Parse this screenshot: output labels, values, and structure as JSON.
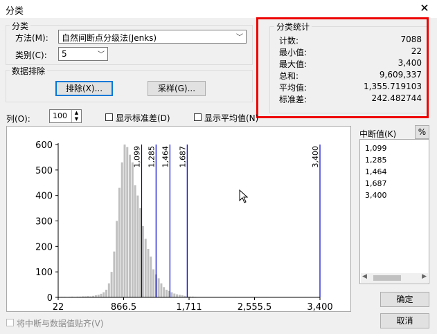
{
  "window": {
    "title": "分类",
    "close_glyph": "✕"
  },
  "classification": {
    "group_label": "分类",
    "method_label": "方法(M):",
    "method_value": "自然间断点分级法(Jenks)",
    "classes_label": "类别(C):",
    "classes_value": "5"
  },
  "exclusion": {
    "group_label": "数据排除",
    "exclude_button": "排除(X)...",
    "sample_button": "采样(G)..."
  },
  "stats": {
    "group_label": "分类统计",
    "rows": [
      {
        "label": "计数:",
        "value": "7088"
      },
      {
        "label": "最小值:",
        "value": "22"
      },
      {
        "label": "最大值:",
        "value": "3,400"
      },
      {
        "label": "总和:",
        "value": "9,609,337"
      },
      {
        "label": "平均值:",
        "value": "1,355.719103"
      },
      {
        "label": "标准差:",
        "value": "242.482744"
      }
    ]
  },
  "columns": {
    "label": "列(O):",
    "value": "100",
    "show_std": "显示标准差(D)",
    "show_mean": "显示平均值(N)"
  },
  "breaks": {
    "label": "中断值(K)",
    "percent_button": "%",
    "values": [
      "1,099",
      "1,285",
      "1,464",
      "1,687",
      "3,400"
    ]
  },
  "buttons": {
    "ok": "确定",
    "cancel": "取消"
  },
  "snap": {
    "label": "将中断与数据值贴齐(V)"
  },
  "colors": {
    "bar": "#c0c0c0",
    "break_line": "#0000cc",
    "highlight": "#e00000"
  },
  "chart_data": {
    "type": "bar",
    "xlim": [
      22,
      3400
    ],
    "ylim": [
      0,
      600
    ],
    "x_ticks": [
      22,
      866.5,
      1711,
      2555.5,
      3400
    ],
    "x_tick_labels": [
      "22",
      "866.5",
      "1,711",
      "2,555.5",
      "3,400"
    ],
    "y_ticks": [
      0,
      100,
      200,
      300,
      400,
      500,
      600
    ],
    "break_values": [
      1099,
      1285,
      1464,
      1687,
      3400
    ],
    "break_labels": [
      "1,099",
      "1,285",
      "1,464",
      "1,687",
      "3,400"
    ],
    "bins": 100,
    "counts": [
      2,
      2,
      2,
      1,
      2,
      3,
      2,
      3,
      3,
      4,
      4,
      5,
      4,
      6,
      8,
      10,
      14,
      20,
      30,
      55,
      100,
      180,
      300,
      430,
      530,
      600,
      590,
      560,
      530,
      440,
      400,
      350,
      280,
      230,
      190,
      160,
      110,
      90,
      75,
      55,
      40,
      30,
      25,
      20,
      15,
      12,
      10,
      8,
      6,
      4,
      3,
      3,
      2,
      1,
      0,
      0,
      0,
      0,
      0,
      0,
      0,
      0,
      0,
      0,
      0,
      0,
      0,
      0,
      0,
      0,
      0,
      0,
      0,
      0,
      0,
      0,
      0,
      0,
      0,
      0,
      0,
      0,
      0,
      0,
      0,
      0,
      0,
      0,
      0,
      0,
      0,
      0,
      0,
      0,
      0,
      0,
      0,
      0,
      1,
      2
    ]
  }
}
